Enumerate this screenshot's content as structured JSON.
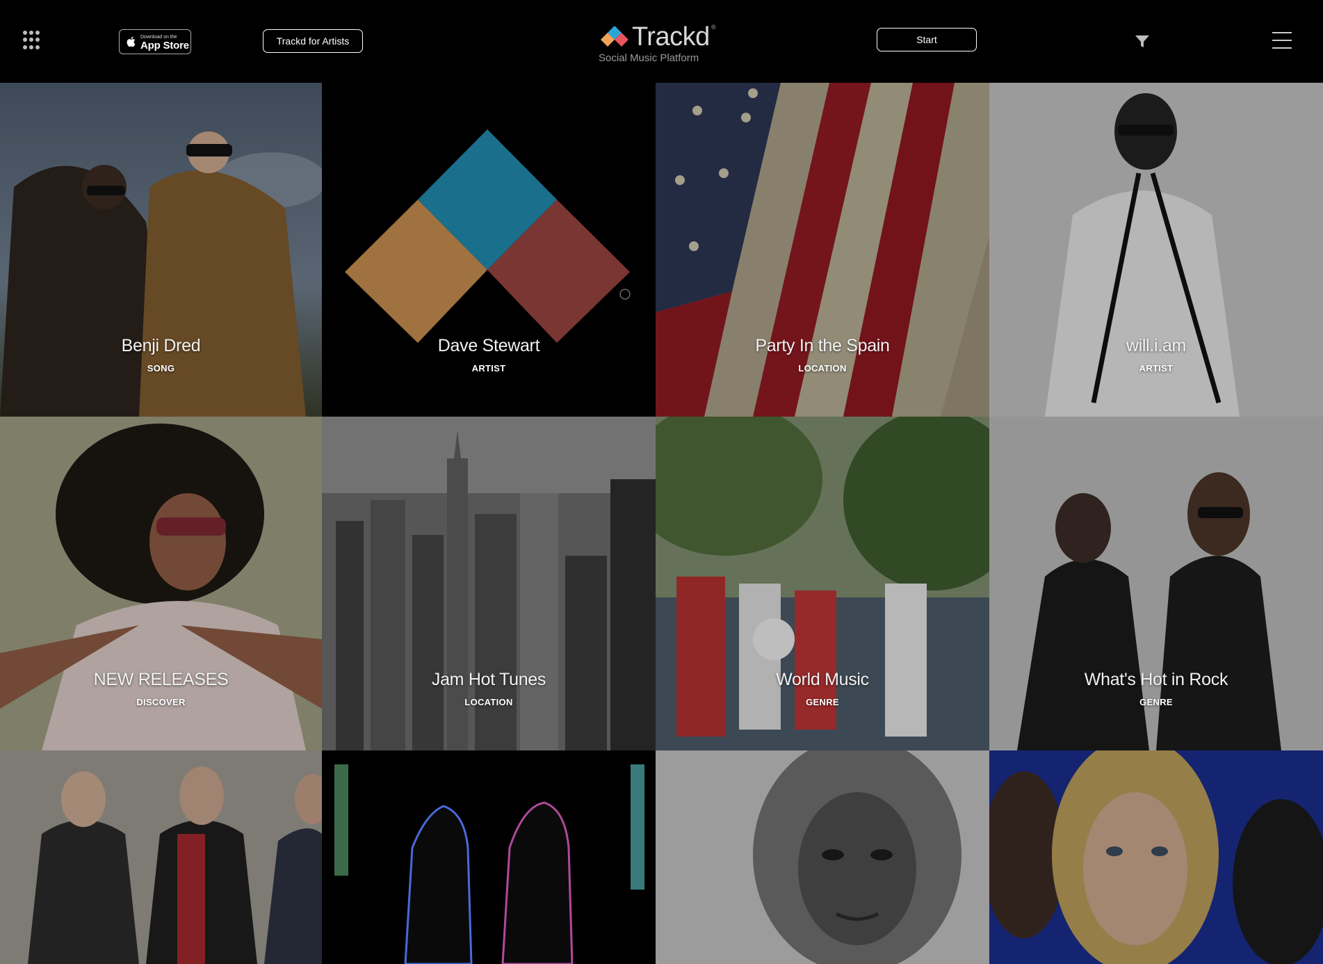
{
  "header": {
    "app_store": {
      "small": "Download on the",
      "big": "App Store"
    },
    "artists_button": "Trackd for Artists",
    "logo": {
      "name": "Trackd",
      "reg": "®",
      "tagline": "Social Music Platform"
    },
    "start_button": "Start",
    "icons": [
      "apps-grid-icon",
      "apple-icon",
      "filter-icon",
      "hamburger-menu-icon"
    ]
  },
  "tiles": [
    {
      "title": "Benji Dred",
      "type": "SONG"
    },
    {
      "title": "Dave Stewart",
      "type": "ARTIST"
    },
    {
      "title": "Party In the Spain",
      "type": "LOCATION"
    },
    {
      "title": "will.i.am",
      "type": "ARTIST"
    },
    {
      "title": "NEW RELEASES",
      "type": "DISCOVER"
    },
    {
      "title": "Jam Hot Tunes",
      "type": "LOCATION"
    },
    {
      "title": "World Music",
      "type": "GENRE"
    },
    {
      "title": "What's Hot in Rock",
      "type": "GENRE"
    },
    {
      "title": "",
      "type": ""
    },
    {
      "title": "",
      "type": ""
    },
    {
      "title": "",
      "type": ""
    },
    {
      "title": "",
      "type": ""
    }
  ],
  "colors": {
    "background": "#000000",
    "logo_blue": "#1a6f8c",
    "logo_orange": "#a0723f",
    "logo_red": "#7a3632",
    "logo_pink": "#e06070"
  }
}
